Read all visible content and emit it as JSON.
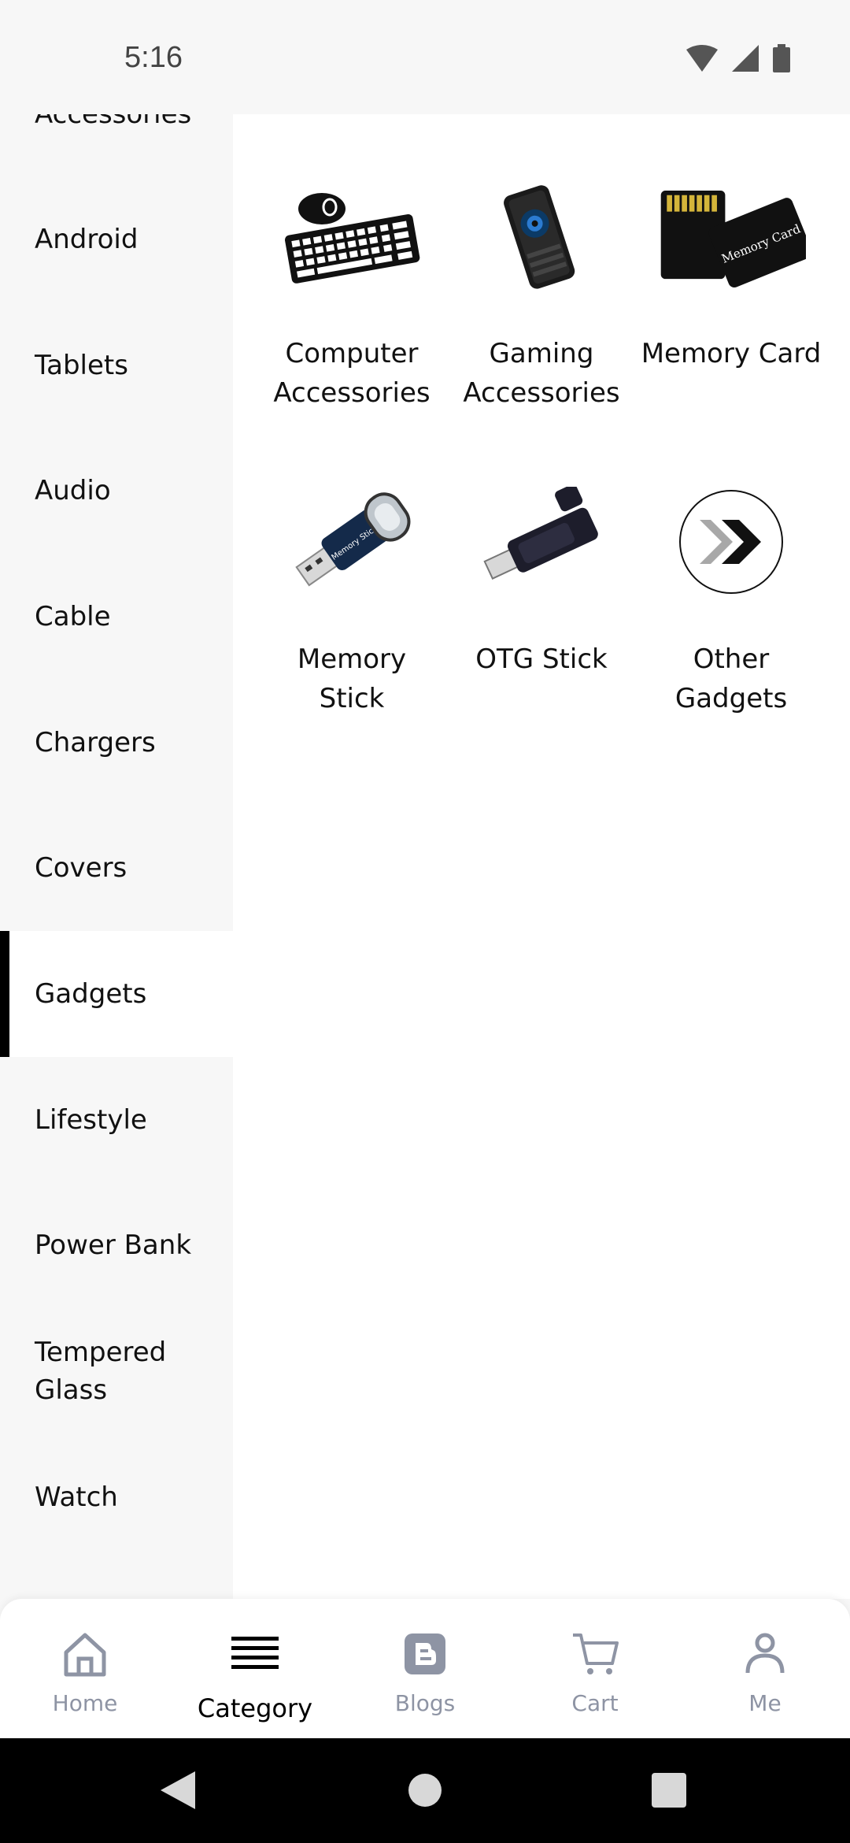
{
  "status": {
    "time": "5:16"
  },
  "sidebar": {
    "items": [
      {
        "label": "Accessories"
      },
      {
        "label": "Android"
      },
      {
        "label": "Tablets"
      },
      {
        "label": "Audio"
      },
      {
        "label": "Cable"
      },
      {
        "label": "Chargers"
      },
      {
        "label": "Covers"
      },
      {
        "label": "Gadgets"
      },
      {
        "label": "Lifestyle"
      },
      {
        "label": "Power Bank"
      },
      {
        "label": "Tempered Glass"
      },
      {
        "label": "Watch"
      }
    ],
    "active": "Gadgets"
  },
  "categories": [
    {
      "label": "Computer Accessories",
      "icon": "keyboard-mouse-image"
    },
    {
      "label": "Gaming Accessories",
      "icon": "gaming-cooler-image"
    },
    {
      "label": "Memory Card",
      "icon": "memory-card-image",
      "image_text": "Memory Card"
    },
    {
      "label": "Memory Stick",
      "icon": "usb-stick-image",
      "image_text": "Memory Stick"
    },
    {
      "label": "OTG Stick",
      "icon": "otg-stick-image"
    },
    {
      "label": "Other Gadgets",
      "icon": "chevron-double-image"
    }
  ],
  "bottom_nav": {
    "items": [
      {
        "label": "Home",
        "icon": "home-icon"
      },
      {
        "label": "Category",
        "icon": "menu-icon"
      },
      {
        "label": "Blogs",
        "icon": "blog-icon"
      },
      {
        "label": "Cart",
        "icon": "cart-icon"
      },
      {
        "label": "Me",
        "icon": "user-icon"
      }
    ],
    "active": "Category"
  },
  "colors": {
    "accent": "#000000",
    "inactive_nav": "#8e94a4",
    "sidebar_bg": "#f7f7f7"
  }
}
